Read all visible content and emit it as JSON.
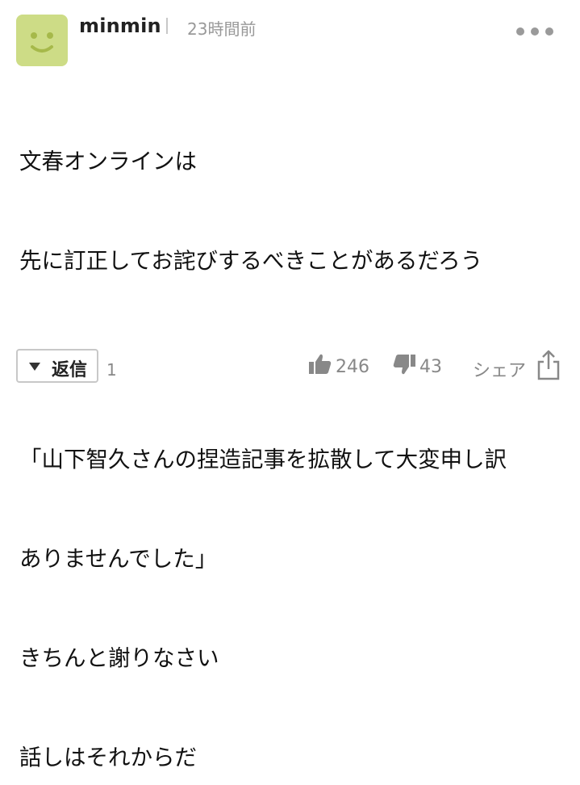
{
  "comment": {
    "username": "minmin",
    "time": "23時間前",
    "lines": [
      "文春オンラインは",
      "先に訂正してお詫びするべきことがあるだろう",
      "",
      "「山下智久さんの捏造記事を拡散して大変申し訳",
      "ありませんでした」",
      "きちんと謝りなさい",
      "話しはそれからだ"
    ]
  },
  "actions": {
    "reply_label": "返信",
    "reply_count": "1",
    "likes": "246",
    "dislikes": "43",
    "share_label": "シェア"
  },
  "colors": {
    "avatar_bg": "#cddc86",
    "avatar_face": "#a6b94a",
    "muted": "#888888"
  }
}
